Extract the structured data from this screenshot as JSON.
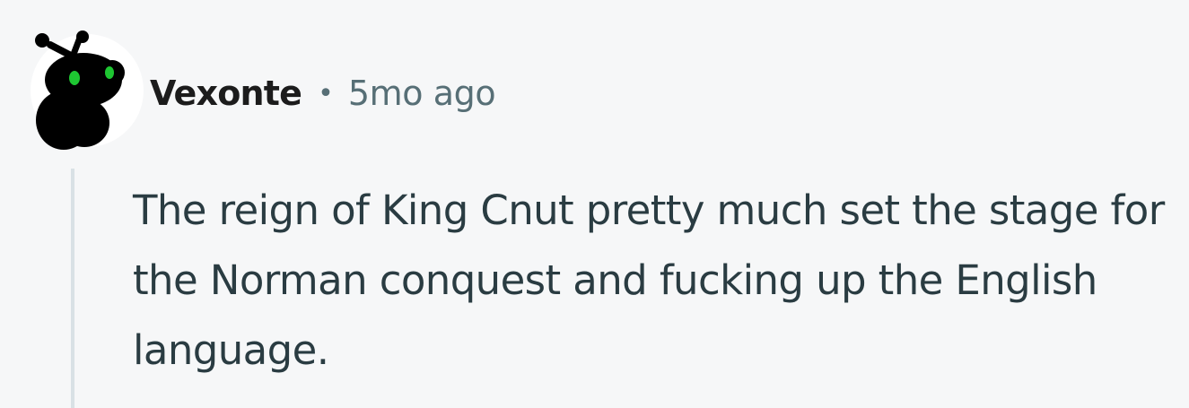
{
  "comment": {
    "username": "Vexonte",
    "separator": "•",
    "timestamp": "5mo ago",
    "body": "The reign of King Cnut pretty much set the stage for the Norman conquest and fucking up the English language."
  },
  "avatar": {
    "icon": "snoo-avatar-icon",
    "background_color": "#ffffff",
    "figure_color": "#000000",
    "eye_color": "#1ec632"
  },
  "colors": {
    "page_background": "#f6f7f8",
    "username_text": "#1c1c1c",
    "meta_text": "#576f76",
    "body_text": "#2a3c42",
    "thread_line": "#d9e1e5"
  }
}
